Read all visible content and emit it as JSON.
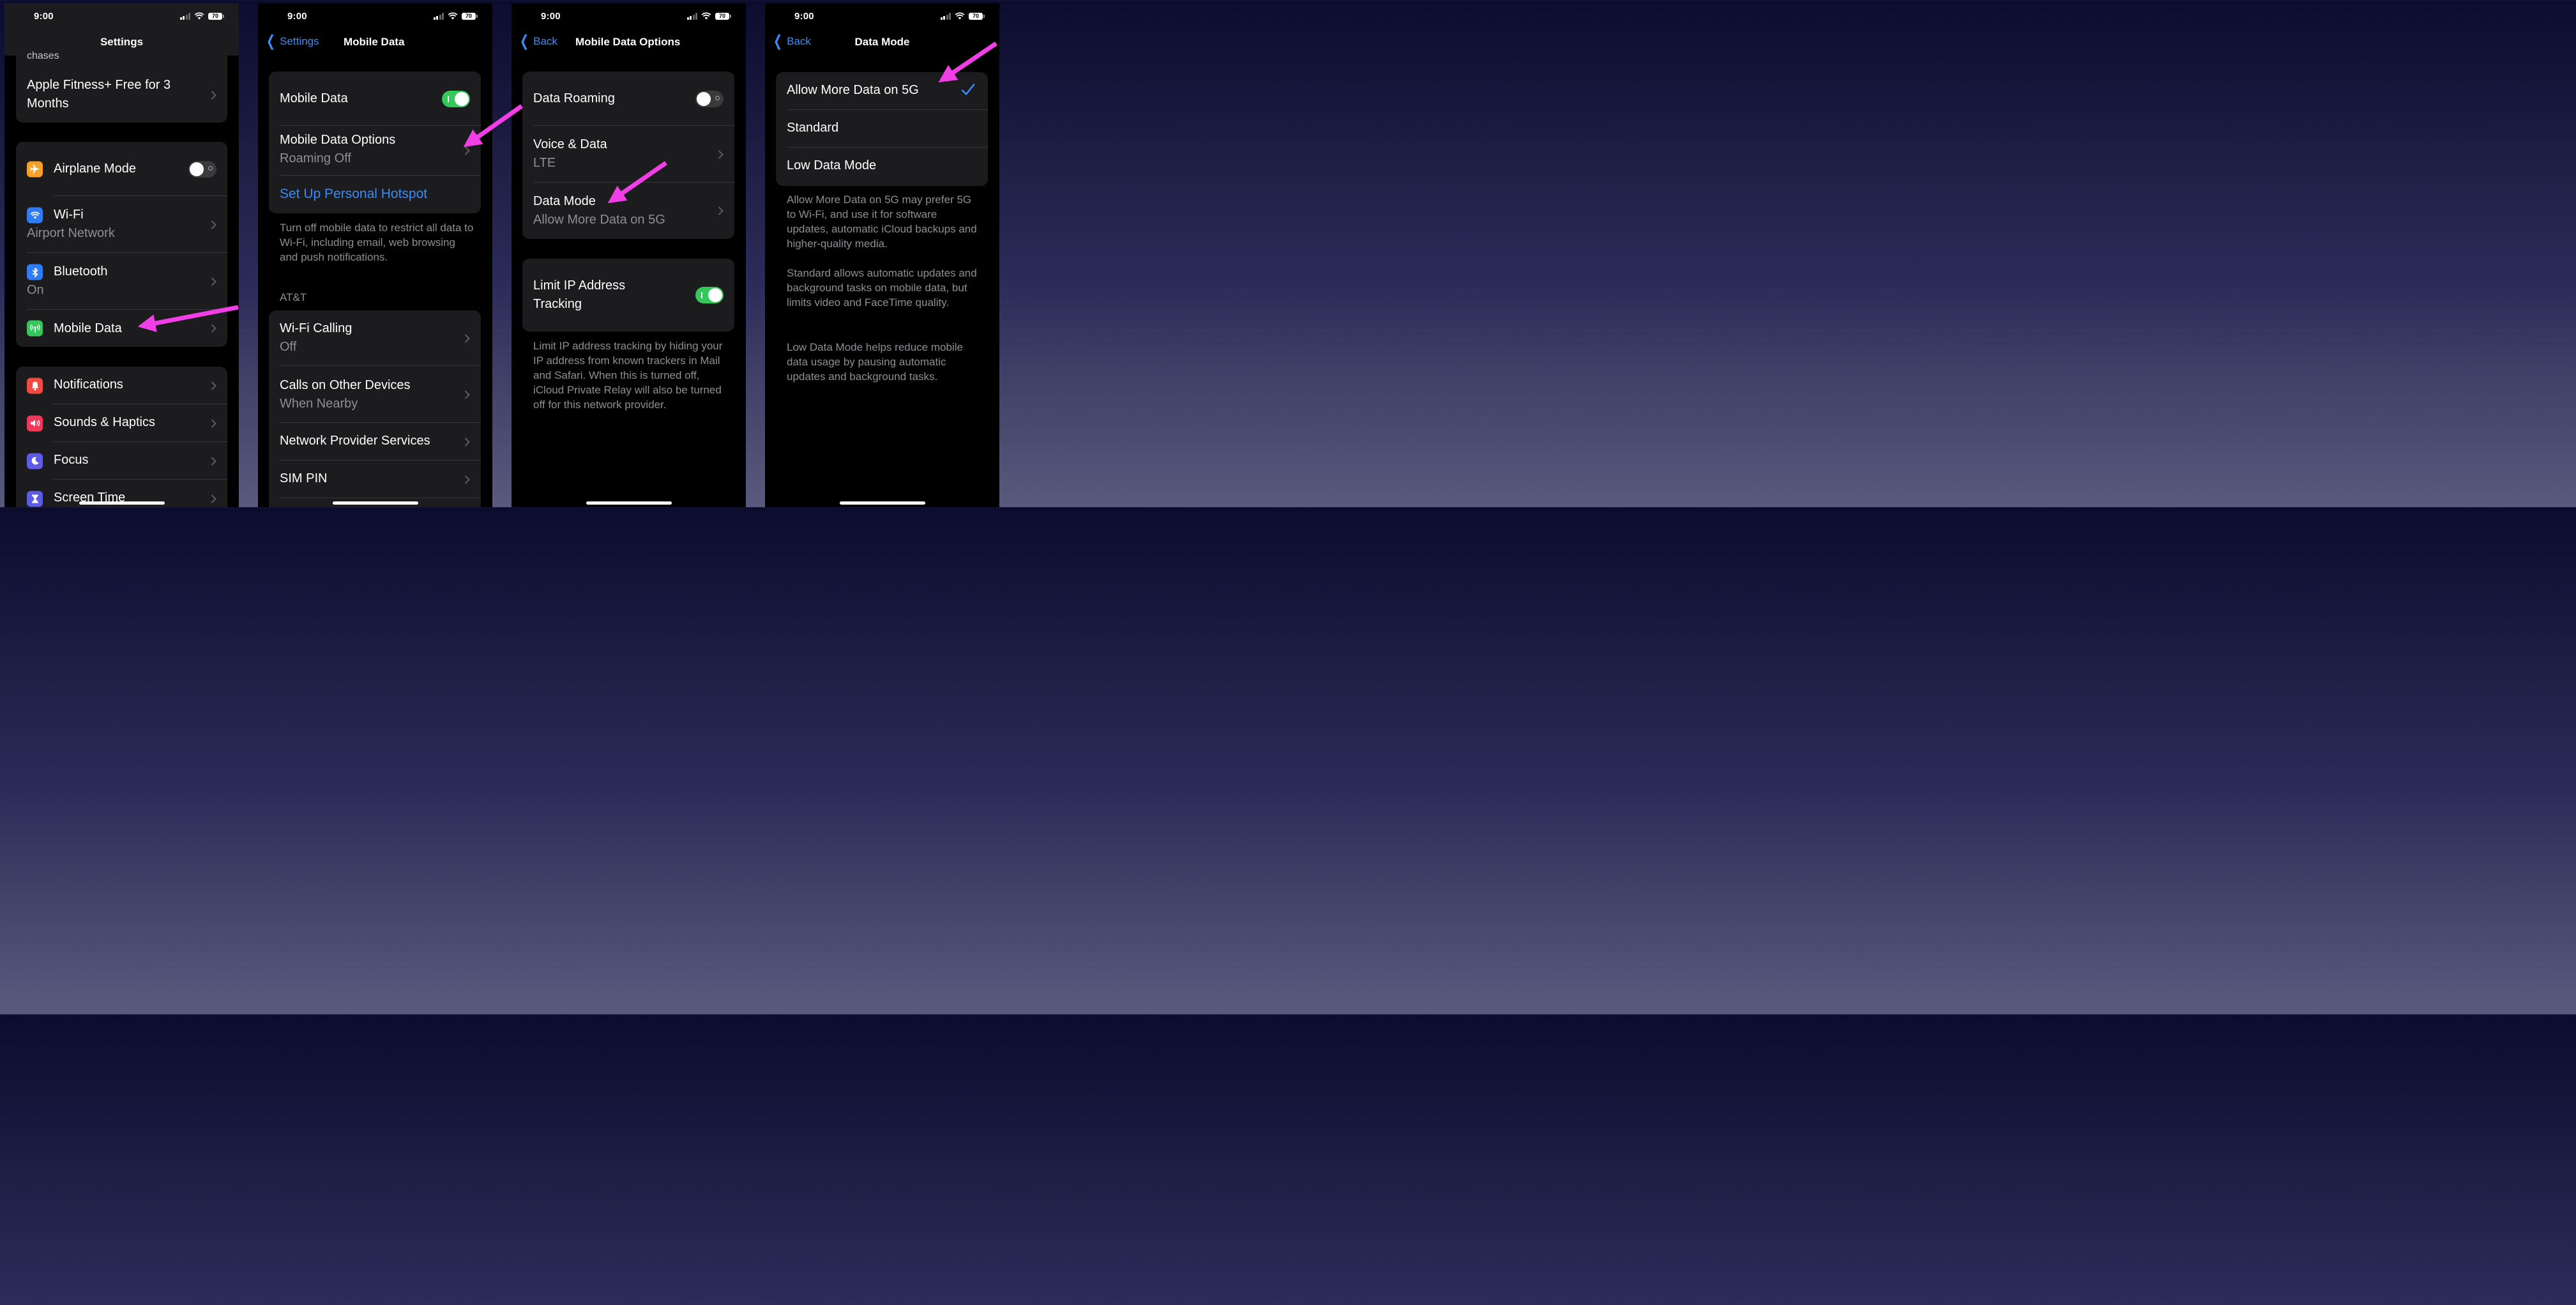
{
  "status": {
    "time": "9:00",
    "battery": "70"
  },
  "panel1": {
    "nav_title": "Settings",
    "top_partial": "chases",
    "fitness": {
      "label": "Apple Fitness+ Free for 3 Months"
    },
    "network": [
      {
        "label": "Airplane Mode",
        "sub": "",
        "icon": "airplane-icon",
        "color": "#f7a02a",
        "toggle": "off"
      },
      {
        "label": "Wi-Fi",
        "sub": "Airport Network",
        "icon": "wifi-icon",
        "color": "#2f7cf6"
      },
      {
        "label": "Bluetooth",
        "sub": "On",
        "icon": "bluetooth-icon",
        "color": "#2f7cf6"
      },
      {
        "label": "Mobile Data",
        "sub": "",
        "icon": "antenna-icon",
        "color": "#34c759"
      }
    ],
    "notify": [
      {
        "label": "Notifications",
        "icon": "bell-icon",
        "color": "#f24941"
      },
      {
        "label": "Sounds & Haptics",
        "icon": "speaker-icon",
        "color": "#f2385a"
      },
      {
        "label": "Focus",
        "icon": "moon-icon",
        "color": "#5e5ce6"
      },
      {
        "label": "Screen Time",
        "icon": "hourglass-icon",
        "color": "#5e5ce6"
      }
    ]
  },
  "panel2": {
    "back": "Settings",
    "nav_title": "Mobile Data",
    "mobile_data": {
      "label": "Mobile Data",
      "toggle": "on"
    },
    "options": {
      "label": "Mobile Data Options",
      "sub": "Roaming Off"
    },
    "hotspot": "Set Up Personal Hotspot",
    "footnote": "Turn off mobile data to restrict all data to Wi-Fi, including email, web browsing and push notifications.",
    "carrier_header": "AT&T",
    "carrier_rows": [
      {
        "label": "Wi-Fi Calling",
        "sub": "Off"
      },
      {
        "label": "Calls on Other Devices",
        "sub": "When Nearby"
      },
      {
        "label": "Network Provider Services",
        "sub": ""
      },
      {
        "label": "SIM PIN",
        "sub": ""
      }
    ]
  },
  "panel3": {
    "back": "Back",
    "nav_title": "Mobile Data Options",
    "roaming": {
      "label": "Data Roaming",
      "toggle": "off"
    },
    "voice": {
      "label": "Voice & Data",
      "sub": "LTE"
    },
    "mode": {
      "label": "Data Mode",
      "sub": "Allow More Data on 5G"
    },
    "limit_ip": {
      "label": "Limit IP Address Tracking",
      "toggle": "on"
    },
    "footnote": "Limit IP address tracking by hiding your IP address from known trackers in Mail and Safari. When this is turned off, iCloud Private Relay will also be turned off for this network provider."
  },
  "panel4": {
    "back": "Back",
    "nav_title": "Data Mode",
    "options": [
      {
        "label": "Allow More Data on 5G",
        "selected": true
      },
      {
        "label": "Standard",
        "selected": false
      },
      {
        "label": "Low Data Mode",
        "selected": false
      }
    ],
    "descriptions": [
      "Allow More Data on 5G may prefer 5G to Wi-Fi, and use it for software updates, automatic iCloud backups and higher-quality media.",
      "Standard allows automatic updates and background tasks on mobile data, but limits video and FaceTime quality.",
      "Low Data Mode helps reduce mobile data usage by pausing automatic updates and background tasks."
    ]
  },
  "colors": {
    "accent": "#3a8cf6",
    "annotation_arrow": "#f23ee6",
    "toggle_on": "#34c759"
  }
}
